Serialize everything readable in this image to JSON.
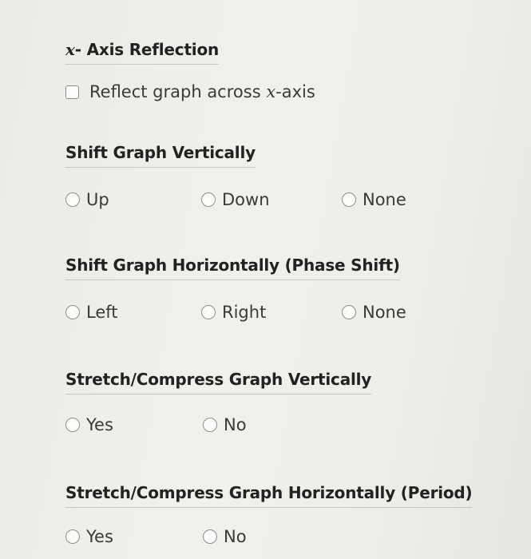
{
  "reflection": {
    "heading_var": "x",
    "heading_rest": "- Axis Reflection",
    "checkbox_label_pre": "Reflect graph across ",
    "checkbox_label_var": "x",
    "checkbox_label_post": "-axis"
  },
  "vertical_shift": {
    "heading": "Shift Graph Vertically",
    "options": [
      "Up",
      "Down",
      "None"
    ]
  },
  "horizontal_shift": {
    "heading": "Shift Graph Horizontally (Phase Shift)",
    "options": [
      "Left",
      "Right",
      "None"
    ]
  },
  "vertical_stretch": {
    "heading": "Stretch/Compress Graph Vertically",
    "options": [
      "Yes",
      "No"
    ]
  },
  "horizontal_stretch": {
    "heading": "Stretch/Compress Graph Horizontally (Period)",
    "options": [
      "Yes",
      "No"
    ]
  }
}
